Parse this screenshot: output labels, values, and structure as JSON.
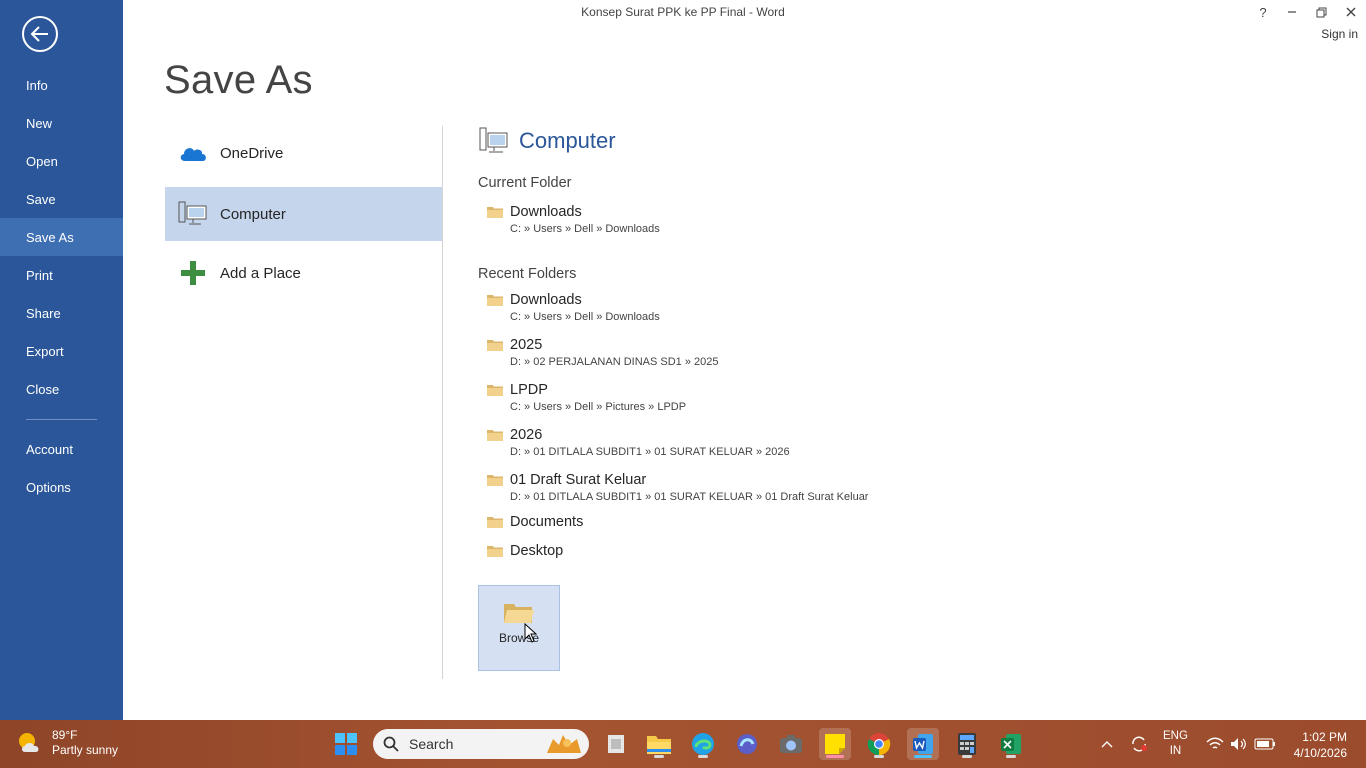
{
  "window": {
    "title": "Konsep Surat PPK ke PP Final - Word",
    "help": "?",
    "minimize": "–",
    "restore": "❐",
    "close": "✕",
    "sign_in": "Sign in"
  },
  "sidebar": {
    "items": [
      {
        "label": "Info"
      },
      {
        "label": "New"
      },
      {
        "label": "Open"
      },
      {
        "label": "Save"
      },
      {
        "label": "Save As"
      },
      {
        "label": "Print"
      },
      {
        "label": "Share"
      },
      {
        "label": "Export"
      },
      {
        "label": "Close"
      },
      {
        "label": "Account"
      },
      {
        "label": "Options"
      }
    ],
    "active": "Save As"
  },
  "page_title": "Save As",
  "places": [
    {
      "label": "OneDrive"
    },
    {
      "label": "Computer"
    },
    {
      "label": "Add a Place"
    }
  ],
  "computer_panel": {
    "header": "Computer",
    "current_folder_label": "Current Folder",
    "current_folder": {
      "name": "Downloads",
      "path": "C: » Users » Dell » Downloads"
    },
    "recent_folders_label": "Recent Folders",
    "recent_folders": [
      {
        "name": "Downloads",
        "path": "C: » Users » Dell » Downloads"
      },
      {
        "name": "2025",
        "path": "D: » 02 PERJALANAN DINAS SD1 » 2025"
      },
      {
        "name": "LPDP",
        "path": "C: » Users » Dell » Pictures » LPDP"
      },
      {
        "name": "2026",
        "path": "D: » 01 DITLALA SUBDIT1 » 01 SURAT KELUAR » 2026"
      },
      {
        "name": "01 Draft Surat Keluar",
        "path": "D: » 01 DITLALA SUBDIT1 » 01 SURAT KELUAR » 01 Draft Surat Keluar"
      },
      {
        "name": "Documents",
        "path": ""
      },
      {
        "name": "Desktop",
        "path": ""
      }
    ],
    "browse_label": "Browse"
  },
  "taskbar": {
    "weather_temp": "89°F",
    "weather_desc": "Partly sunny",
    "search_placeholder": "Search",
    "lang_top": "ENG",
    "lang_bottom": "IN",
    "time": "1:02 PM",
    "date": "4/10/2026"
  },
  "colors": {
    "sidebar": "#2b579a",
    "sidebar_active": "#3f6fb3",
    "place_active": "#c5d5ec",
    "accent": "#2b579a"
  }
}
